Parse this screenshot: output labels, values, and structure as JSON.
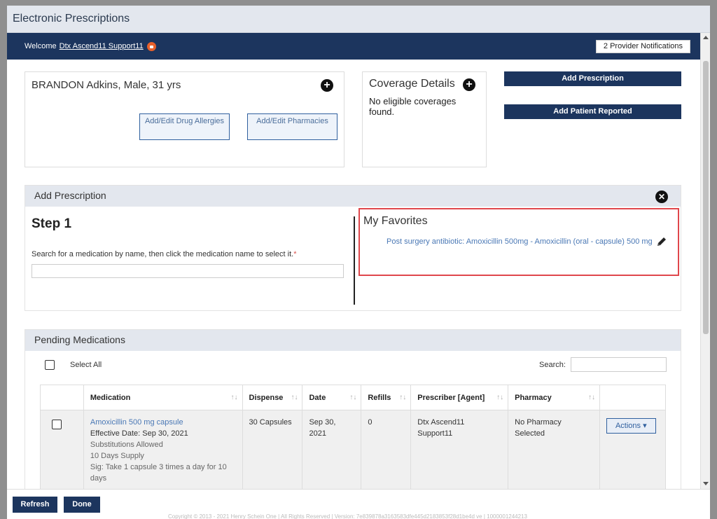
{
  "window": {
    "title": "Electronic Prescriptions"
  },
  "welcome": {
    "prefix": "Welcome",
    "user": "Dtx Ascend11 Support11",
    "notifications": "2 Provider Notifications"
  },
  "patient": {
    "name": "BRANDON Adkins, Male, 31 yrs",
    "allergies_button": "Add/Edit Drug Allergies",
    "pharmacies_button": "Add/Edit Pharmacies"
  },
  "coverage": {
    "title": "Coverage Details",
    "message": "No eligible coverages found."
  },
  "actions": {
    "add_prescription": "Add Prescription",
    "add_patient_reported": "Add Patient Reported"
  },
  "add_prescription_panel": {
    "header": "Add Prescription",
    "step_title": "Step 1",
    "instruction": "Search for a medication by name, then click the medication name to select it.",
    "required_mark": "*",
    "search_value": "",
    "favorites_title": "My Favorites",
    "favorite_item": "Post surgery antibiotic: Amoxicillin 500mg - Amoxicillin (oral - capsule) 500 mg"
  },
  "pending": {
    "header": "Pending Medications",
    "select_all": "Select All",
    "search_label": "Search:",
    "search_value": "",
    "columns": [
      "Medication",
      "Dispense",
      "Date",
      "Refills",
      "Prescriber [Agent]",
      "Pharmacy",
      ""
    ],
    "rows": [
      {
        "medication": "Amoxicillin 500 mg capsule",
        "effective": "Effective Date: Sep 30, 2021",
        "substitutions": "Substitutions Allowed",
        "supply": "10 Days Supply",
        "sig": "Sig: Take 1 capsule 3 times a day for 10 days",
        "dispense": "30 Capsules",
        "date": "Sep 30, 2021",
        "refills": "0",
        "prescriber": "Dtx Ascend11 Support11",
        "pharmacy": "No Pharmacy Selected",
        "actions_label": "Actions"
      }
    ]
  },
  "footer": {
    "refresh": "Refresh",
    "done": "Done",
    "copyright": "Copyright © 2013 - 2021 Henry Schein One | All Rights Reserved | Version: 7e839878a3163583dfe445d2183853f28d1be4d ve | 1000001244213"
  }
}
